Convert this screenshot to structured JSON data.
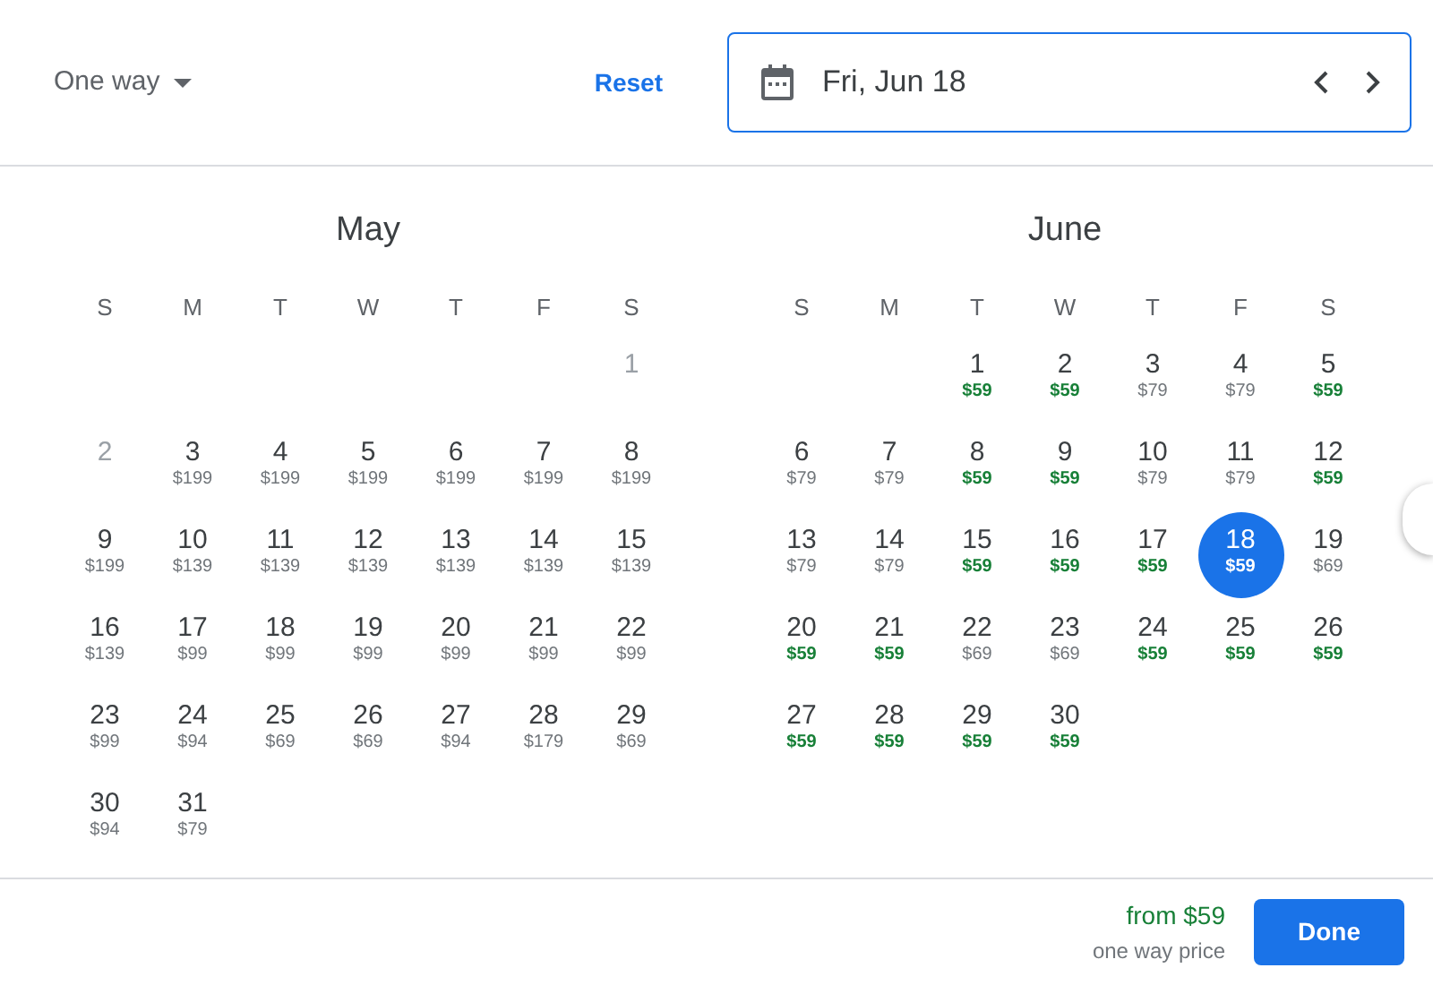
{
  "header": {
    "trip_type": "One way",
    "reset": "Reset",
    "date_field": {
      "value": "Fri, Jun 18"
    }
  },
  "months": [
    {
      "name": "May",
      "weekdays": [
        "S",
        "M",
        "T",
        "W",
        "T",
        "F",
        "S"
      ],
      "weeks": [
        [
          {
            "kind": "blank"
          },
          {
            "kind": "blank"
          },
          {
            "kind": "blank"
          },
          {
            "kind": "blank"
          },
          {
            "kind": "blank"
          },
          {
            "kind": "blank"
          },
          {
            "kind": "date",
            "day": "1",
            "disabled": true,
            "selected": false
          }
        ],
        [
          {
            "kind": "date",
            "day": "2",
            "disabled": true,
            "selected": false
          },
          {
            "kind": "date",
            "day": "3",
            "price": "$199",
            "cheap": false,
            "disabled": false,
            "selected": false
          },
          {
            "kind": "date",
            "day": "4",
            "price": "$199",
            "cheap": false,
            "disabled": false,
            "selected": false
          },
          {
            "kind": "date",
            "day": "5",
            "price": "$199",
            "cheap": false,
            "disabled": false,
            "selected": false
          },
          {
            "kind": "date",
            "day": "6",
            "price": "$199",
            "cheap": false,
            "disabled": false,
            "selected": false
          },
          {
            "kind": "date",
            "day": "7",
            "price": "$199",
            "cheap": false,
            "disabled": false,
            "selected": false
          },
          {
            "kind": "date",
            "day": "8",
            "price": "$199",
            "cheap": false,
            "disabled": false,
            "selected": false
          }
        ],
        [
          {
            "kind": "date",
            "day": "9",
            "price": "$199",
            "cheap": false,
            "disabled": false,
            "selected": false
          },
          {
            "kind": "date",
            "day": "10",
            "price": "$139",
            "cheap": false,
            "disabled": false,
            "selected": false
          },
          {
            "kind": "date",
            "day": "11",
            "price": "$139",
            "cheap": false,
            "disabled": false,
            "selected": false
          },
          {
            "kind": "date",
            "day": "12",
            "price": "$139",
            "cheap": false,
            "disabled": false,
            "selected": false
          },
          {
            "kind": "date",
            "day": "13",
            "price": "$139",
            "cheap": false,
            "disabled": false,
            "selected": false
          },
          {
            "kind": "date",
            "day": "14",
            "price": "$139",
            "cheap": false,
            "disabled": false,
            "selected": false
          },
          {
            "kind": "date",
            "day": "15",
            "price": "$139",
            "cheap": false,
            "disabled": false,
            "selected": false
          }
        ],
        [
          {
            "kind": "date",
            "day": "16",
            "price": "$139",
            "cheap": false,
            "disabled": false,
            "selected": false
          },
          {
            "kind": "date",
            "day": "17",
            "price": "$99",
            "cheap": false,
            "disabled": false,
            "selected": false
          },
          {
            "kind": "date",
            "day": "18",
            "price": "$99",
            "cheap": false,
            "disabled": false,
            "selected": false
          },
          {
            "kind": "date",
            "day": "19",
            "price": "$99",
            "cheap": false,
            "disabled": false,
            "selected": false
          },
          {
            "kind": "date",
            "day": "20",
            "price": "$99",
            "cheap": false,
            "disabled": false,
            "selected": false
          },
          {
            "kind": "date",
            "day": "21",
            "price": "$99",
            "cheap": false,
            "disabled": false,
            "selected": false
          },
          {
            "kind": "date",
            "day": "22",
            "price": "$99",
            "cheap": false,
            "disabled": false,
            "selected": false
          }
        ],
        [
          {
            "kind": "date",
            "day": "23",
            "price": "$99",
            "cheap": false,
            "disabled": false,
            "selected": false
          },
          {
            "kind": "date",
            "day": "24",
            "price": "$94",
            "cheap": false,
            "disabled": false,
            "selected": false
          },
          {
            "kind": "date",
            "day": "25",
            "price": "$69",
            "cheap": false,
            "disabled": false,
            "selected": false
          },
          {
            "kind": "date",
            "day": "26",
            "price": "$69",
            "cheap": false,
            "disabled": false,
            "selected": false
          },
          {
            "kind": "date",
            "day": "27",
            "price": "$94",
            "cheap": false,
            "disabled": false,
            "selected": false
          },
          {
            "kind": "date",
            "day": "28",
            "price": "$179",
            "cheap": false,
            "disabled": false,
            "selected": false
          },
          {
            "kind": "date",
            "day": "29",
            "price": "$69",
            "cheap": false,
            "disabled": false,
            "selected": false
          }
        ],
        [
          {
            "kind": "date",
            "day": "30",
            "price": "$94",
            "cheap": false,
            "disabled": false,
            "selected": false
          },
          {
            "kind": "date",
            "day": "31",
            "price": "$79",
            "cheap": false,
            "disabled": false,
            "selected": false
          }
        ]
      ]
    },
    {
      "name": "June",
      "weekdays": [
        "S",
        "M",
        "T",
        "W",
        "T",
        "F",
        "S"
      ],
      "weeks": [
        [
          {
            "kind": "blank"
          },
          {
            "kind": "blank"
          },
          {
            "kind": "date",
            "day": "1",
            "price": "$59",
            "cheap": true,
            "disabled": false,
            "selected": false
          },
          {
            "kind": "date",
            "day": "2",
            "price": "$59",
            "cheap": true,
            "disabled": false,
            "selected": false
          },
          {
            "kind": "date",
            "day": "3",
            "price": "$79",
            "cheap": false,
            "disabled": false,
            "selected": false
          },
          {
            "kind": "date",
            "day": "4",
            "price": "$79",
            "cheap": false,
            "disabled": false,
            "selected": false
          },
          {
            "kind": "date",
            "day": "5",
            "price": "$59",
            "cheap": true,
            "disabled": false,
            "selected": false
          }
        ],
        [
          {
            "kind": "date",
            "day": "6",
            "price": "$79",
            "cheap": false,
            "disabled": false,
            "selected": false
          },
          {
            "kind": "date",
            "day": "7",
            "price": "$79",
            "cheap": false,
            "disabled": false,
            "selected": false
          },
          {
            "kind": "date",
            "day": "8",
            "price": "$59",
            "cheap": true,
            "disabled": false,
            "selected": false
          },
          {
            "kind": "date",
            "day": "9",
            "price": "$59",
            "cheap": true,
            "disabled": false,
            "selected": false
          },
          {
            "kind": "date",
            "day": "10",
            "price": "$79",
            "cheap": false,
            "disabled": false,
            "selected": false
          },
          {
            "kind": "date",
            "day": "11",
            "price": "$79",
            "cheap": false,
            "disabled": false,
            "selected": false
          },
          {
            "kind": "date",
            "day": "12",
            "price": "$59",
            "cheap": true,
            "disabled": false,
            "selected": false
          }
        ],
        [
          {
            "kind": "date",
            "day": "13",
            "price": "$79",
            "cheap": false,
            "disabled": false,
            "selected": false
          },
          {
            "kind": "date",
            "day": "14",
            "price": "$79",
            "cheap": false,
            "disabled": false,
            "selected": false
          },
          {
            "kind": "date",
            "day": "15",
            "price": "$59",
            "cheap": true,
            "disabled": false,
            "selected": false
          },
          {
            "kind": "date",
            "day": "16",
            "price": "$59",
            "cheap": true,
            "disabled": false,
            "selected": false
          },
          {
            "kind": "date",
            "day": "17",
            "price": "$59",
            "cheap": true,
            "disabled": false,
            "selected": false
          },
          {
            "kind": "date",
            "day": "18",
            "price": "$59",
            "cheap": true,
            "disabled": false,
            "selected": true
          },
          {
            "kind": "date",
            "day": "19",
            "price": "$69",
            "cheap": false,
            "disabled": false,
            "selected": false
          }
        ],
        [
          {
            "kind": "date",
            "day": "20",
            "price": "$59",
            "cheap": true,
            "disabled": false,
            "selected": false
          },
          {
            "kind": "date",
            "day": "21",
            "price": "$59",
            "cheap": true,
            "disabled": false,
            "selected": false
          },
          {
            "kind": "date",
            "day": "22",
            "price": "$69",
            "cheap": false,
            "disabled": false,
            "selected": false
          },
          {
            "kind": "date",
            "day": "23",
            "price": "$69",
            "cheap": false,
            "disabled": false,
            "selected": false
          },
          {
            "kind": "date",
            "day": "24",
            "price": "$59",
            "cheap": true,
            "disabled": false,
            "selected": false
          },
          {
            "kind": "date",
            "day": "25",
            "price": "$59",
            "cheap": true,
            "disabled": false,
            "selected": false
          },
          {
            "kind": "date",
            "day": "26",
            "price": "$59",
            "cheap": true,
            "disabled": false,
            "selected": false
          }
        ],
        [
          {
            "kind": "date",
            "day": "27",
            "price": "$59",
            "cheap": true,
            "disabled": false,
            "selected": false
          },
          {
            "kind": "date",
            "day": "28",
            "price": "$59",
            "cheap": true,
            "disabled": false,
            "selected": false
          },
          {
            "kind": "date",
            "day": "29",
            "price": "$59",
            "cheap": true,
            "disabled": false,
            "selected": false
          },
          {
            "kind": "date",
            "day": "30",
            "price": "$59",
            "cheap": true,
            "disabled": false,
            "selected": false
          }
        ]
      ]
    }
  ],
  "footer": {
    "from_price": "from $59",
    "price_note": "one way price",
    "done": "Done"
  }
}
